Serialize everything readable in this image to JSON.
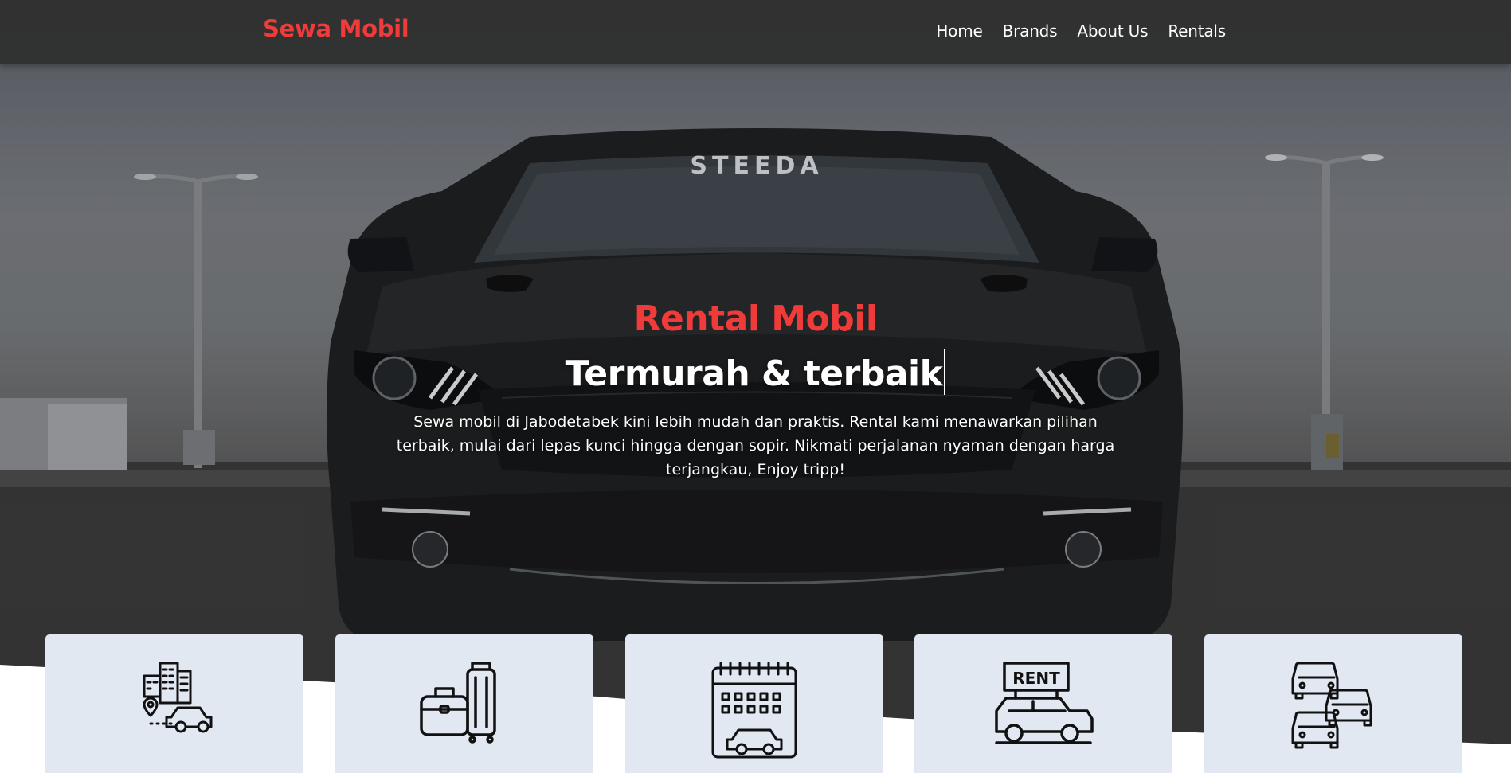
{
  "navbar": {
    "brand": "Sewa Mobil",
    "links": [
      "Home",
      "Brands",
      "About Us",
      "Rentals"
    ]
  },
  "hero": {
    "title": "Rental Mobil",
    "subtitle": "Termurah & terbaik",
    "description": "Sewa mobil di Jabodetabek kini lebih mudah dan praktis. Rental kami menawarkan pilihan terbaik, mulai dari lepas kunci hingga dengan sopir. Nikmati perjalanan nyaman dengan harga terjangkau, Enjoy tripp!",
    "windshield_text": "STEEDA"
  },
  "service_cards": [
    {
      "icon": "city-car-location-icon"
    },
    {
      "icon": "luggage-icon"
    },
    {
      "icon": "calendar-car-icon"
    },
    {
      "icon": "rent-car-icon"
    },
    {
      "icon": "multiple-cars-icon"
    }
  ],
  "rent_sign_text": "RENT",
  "colors": {
    "brand": "#ef3b3a",
    "navbar_bg": "#2d2d2e",
    "card_bg": "#e1e8f2",
    "text_light": "#ffffff"
  }
}
